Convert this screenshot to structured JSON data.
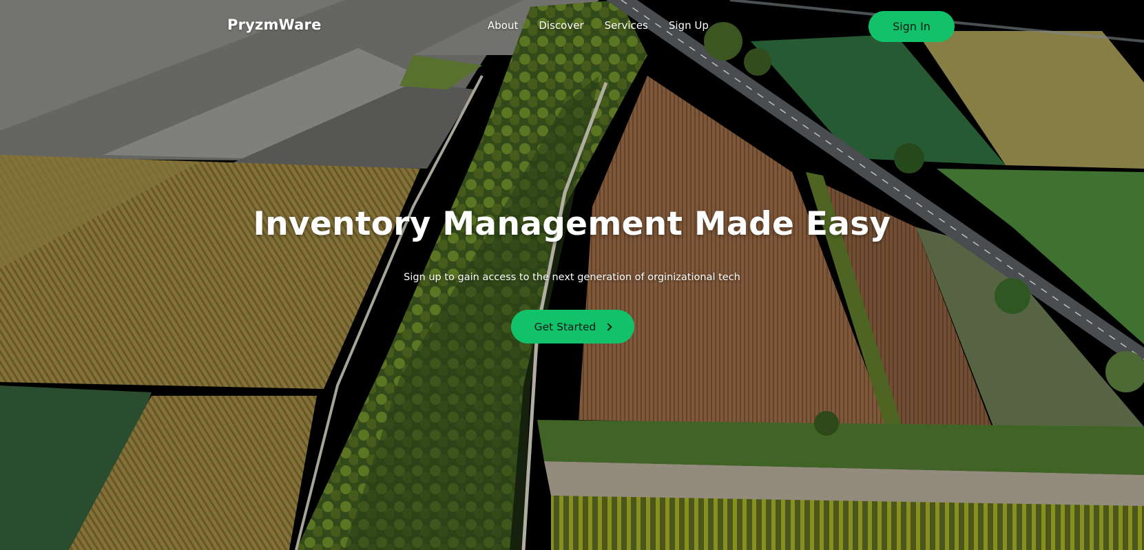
{
  "brand": {
    "name": "PryzmWare",
    "accent_color": "#12c26a"
  },
  "nav": {
    "links": [
      "About",
      "Discover",
      "Services",
      "Sign Up"
    ],
    "signin_label": "Sign In"
  },
  "hero": {
    "title": "Inventory Management Made Easy",
    "subtitle": "Sign up to gain access to the next generation of orginizational tech",
    "cta_label": "Get Started",
    "cta_icon": "chevron-right-icon",
    "background": "aerial-farmland-video"
  }
}
